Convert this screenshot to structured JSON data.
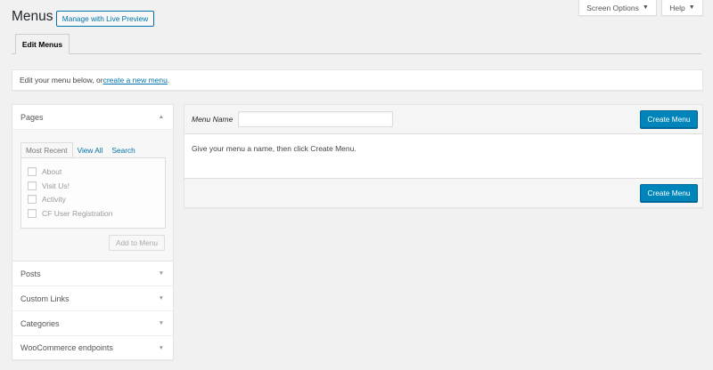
{
  "screen_meta": {
    "screen_options": "Screen Options",
    "help": "Help",
    "arrow": "▼"
  },
  "header": {
    "title": "Menus",
    "live_preview_button": "Manage with Live Preview"
  },
  "tabs": [
    {
      "label": "Edit Menus",
      "active": true
    }
  ],
  "notice": {
    "text_before": "Edit your menu below, or ",
    "link": "create a new menu",
    "text_after": "."
  },
  "sidebar": {
    "sections": [
      {
        "title": "Pages",
        "expanded": true
      },
      {
        "title": "Posts",
        "expanded": false
      },
      {
        "title": "Custom Links",
        "expanded": false
      },
      {
        "title": "Categories",
        "expanded": false
      },
      {
        "title": "WooCommerce endpoints",
        "expanded": false
      }
    ],
    "pages": {
      "tabs": [
        "Most Recent",
        "View All",
        "Search"
      ],
      "items": [
        "About",
        "Visit Us!",
        "Activity",
        "CF User Registration"
      ],
      "add_button": "Add to Menu"
    },
    "icons": {
      "collapse": "▲",
      "expand": "▼"
    }
  },
  "menu_editor": {
    "menu_name_label": "Menu Name",
    "menu_name_value": "",
    "create_button": "Create Menu",
    "instructions": "Give your menu a name, then click Create Menu."
  },
  "colors": {
    "accent": "#0073aa",
    "primary_button": "#0085ba",
    "background": "#f1f1f1"
  }
}
